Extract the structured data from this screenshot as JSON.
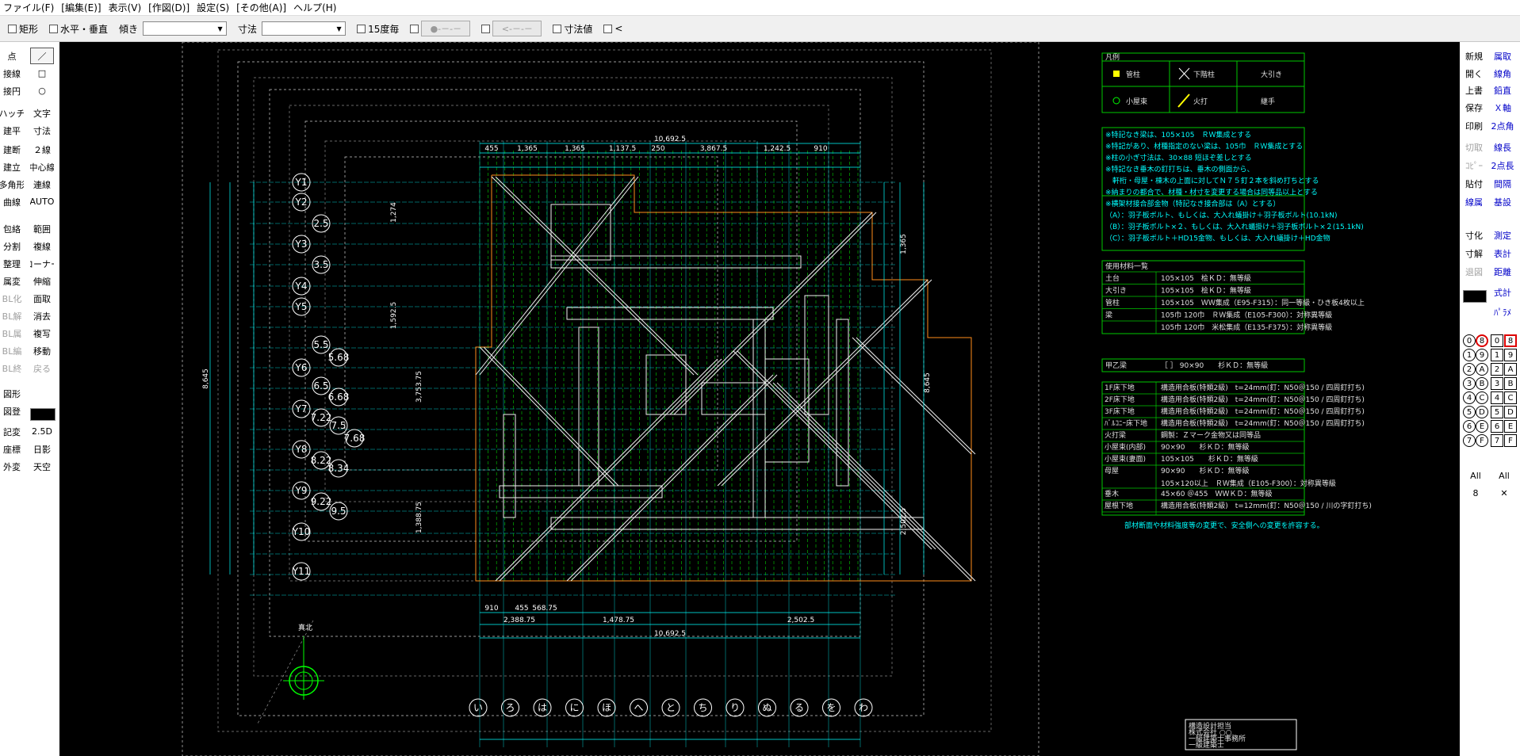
{
  "menu": [
    "ファイル(F)",
    "[編集(E)]",
    "表示(V)",
    "[作図(D)]",
    "設定(S)",
    "[その他(A)]",
    "ヘルプ(H)"
  ],
  "toolbar": {
    "rect_label": "矩形",
    "hv_label": "水平・垂直",
    "tilt_label": "傾き",
    "tilt_value": "",
    "dim_label": "寸法",
    "dim_value": "",
    "deg15_label": "15度毎",
    "btn1_label": "●-－-－",
    "btn2_label": "<-－-－",
    "dimval_label": "寸法値",
    "lt_label": "<"
  },
  "left_tools": [
    [
      "点",
      "／"
    ],
    [
      "接線",
      "□"
    ],
    [
      "接円",
      "○"
    ],
    [
      "ハッチ",
      "文字"
    ],
    [
      "建平",
      "寸法"
    ],
    [
      "建断",
      "２線"
    ],
    [
      "建立",
      "中心線"
    ],
    [
      "多角形",
      "連線"
    ],
    [
      "曲線",
      "AUTO"
    ],
    [
      "包絡",
      "範囲"
    ],
    [
      "分割",
      "複線"
    ],
    [
      "整理",
      "コーナー"
    ],
    [
      "属変",
      "伸縮"
    ],
    [
      "BL化",
      "面取"
    ],
    [
      "BL解",
      "消去"
    ],
    [
      "BL属",
      "複写"
    ],
    [
      "BL編",
      "移動"
    ],
    [
      "BL終",
      "戻る"
    ],
    [
      "図形",
      ""
    ],
    [
      "図登",
      ""
    ],
    [
      "記変",
      "2.5D"
    ],
    [
      "座標",
      "日影"
    ],
    [
      "外変",
      "天空"
    ]
  ],
  "right_tools": [
    [
      "新規",
      "属取"
    ],
    [
      "開く",
      "線角"
    ],
    [
      "上書",
      "鉛直"
    ],
    [
      "保存",
      "Ｘ軸"
    ],
    [
      "印刷",
      "2点角"
    ],
    [
      "切取",
      "線長"
    ],
    [
      "ｺﾋﾟｰ",
      "2点長"
    ],
    [
      "貼付",
      "間隔"
    ],
    [
      "線属",
      "基設"
    ],
    [
      "寸化",
      "測定"
    ],
    [
      "寸解",
      "表計"
    ],
    [
      "退図",
      "距離"
    ],
    [
      "",
      "式計"
    ],
    [
      "",
      "ﾊﾟﾗﾒ"
    ]
  ],
  "layer_groups": [
    "0",
    "1",
    "2",
    "3",
    "4",
    "5",
    "6",
    "7",
    "8",
    "9",
    "A",
    "B",
    "C",
    "D",
    "E",
    "F"
  ],
  "layer_all": "All",
  "layer_current": "8",
  "legend": {
    "title": "凡例",
    "items": [
      "管柱",
      "下階柱",
      "大引き",
      "小屋束",
      "火打",
      "継手"
    ]
  },
  "notes": [
    "※特記なき梁は、105×105　ＲＷ集成とする",
    "※特記があり、材種指定のない梁は、105巾　ＲＷ集成とする",
    "※柱の小ぎ寸法は、30×88 短ほぞ差しとする",
    "※特記なき垂木の釘打ちは、垂木の側面から、",
    "　軒桁・母屋・棟木の上面に対してＮ７５釘２本を斜め打ちとする",
    "※納まりの都合で、材種・材寸を変更する場合は同等品以上とする",
    "※横架材接合部金物（特記なき接合部は（A）とする）",
    "（A）：羽子板ボルト、もしくは、大入れ蟻掛け＋羽子板ボルト(10.1kN)",
    "（B）：羽子板ボルト×２、もしくは、大入れ蟻掛け＋羽子板ボルト×２(15.1kN)",
    "（C）：羽子板ボルト＋HD15金物、もしくは、大入れ蟻掛け＋HD金物"
  ],
  "materials": {
    "title": "使用材料一覧",
    "rows": [
      [
        "土台",
        "105×105　桧ＫＤ：無等級"
      ],
      [
        "大引き",
        "105×105　桧ＫＤ：無等級"
      ],
      [
        "管柱",
        "105×105　ＷＷ集成（E95-F315）：同一等級・ひき板4枚以上"
      ],
      [
        "梁",
        "105巾 120巾　ＲＷ集成（E105-F300）：対称異等級"
      ],
      [
        "",
        "105巾 120巾　米松集成（E135-F375）：対称異等級"
      ]
    ],
    "strut_row": [
      "甲乙梁",
      "［ ］ 90×90　　杉ＫＤ：無等級"
    ],
    "rows2": [
      [
        "1F床下地",
        "構造用合板(特類2級)　t=24mm(釘：N50＠150 / 四周釘打ち)"
      ],
      [
        "2F床下地",
        "構造用合板(特類2級)　t=24mm(釘：N50＠150 / 四周釘打ち)"
      ],
      [
        "3F床下地",
        "構造用合板(特類2級)　t=24mm(釘：N50＠150 / 四周釘打ち)"
      ],
      [
        "ﾊﾞﾙｺﾆｰ床下地",
        "構造用合板(特類2級)　t=24mm(釘：N50＠150 / 四周釘打ち)"
      ],
      [
        "火打梁",
        "鋼製：Ｚマーク金物又は同等品"
      ],
      [
        "小屋束(内部)",
        "90×90　　杉ＫＤ：無等級"
      ],
      [
        "小屋束(妻面)",
        "105×105　　杉ＫＤ：無等級"
      ],
      [
        "母屋",
        "90×90　　杉ＫＤ：無等級"
      ],
      [
        "",
        "105×120以上　ＲＷ集成（E105-F300）：対称異等級"
      ],
      [
        "垂木",
        "45×60 ＠455　ＷＷＫＤ：無等級"
      ],
      [
        "屋根下地",
        "構造用合板(特類2級)　t=12mm(釘：N50＠150 / 川の字釘打ち)"
      ]
    ],
    "footer": "部材断面や材料強度等の変更で、安全側への変更を許容する。"
  },
  "grid_y": [
    "Y1",
    "Y2",
    "2.5",
    "Y3",
    "3.5",
    "Y4",
    "Y5",
    "5.5",
    "5.68",
    "Y6",
    "6.5",
    "6.68",
    "Y7",
    "7.22",
    "7.5",
    "7.68",
    "Y8",
    "8.22",
    "8.34",
    "Y9",
    "9.22",
    "9.5",
    "Y10",
    "Y11"
  ],
  "grid_x": [
    "い",
    "ろ",
    "は",
    "に",
    "ほ",
    "へ",
    "と",
    "ち",
    "り",
    "ぬ",
    "る",
    "を",
    "わ"
  ],
  "dims_top": [
    "10,692.5",
    "455",
    "1,365",
    "1,365",
    "1,137.5",
    "250",
    "3,867.5",
    "1,242.5",
    "910"
  ],
  "dims_bottom": [
    "910",
    "455",
    "568.75",
    "10,692.5",
    "2,388.75",
    "1,478.75",
    "2,502.5"
  ],
  "dims_left": [
    "8,645",
    "1,592.5",
    "3,753.75",
    "1,274",
    "1,388.75"
  ],
  "dims_right": [
    "8,645",
    "1,365",
    "2,502.5"
  ],
  "north_label": "真北",
  "title_block": [
    "構造設計担当",
    "株式会社 ○○",
    "一級建築士事務所",
    "一級建築士"
  ]
}
